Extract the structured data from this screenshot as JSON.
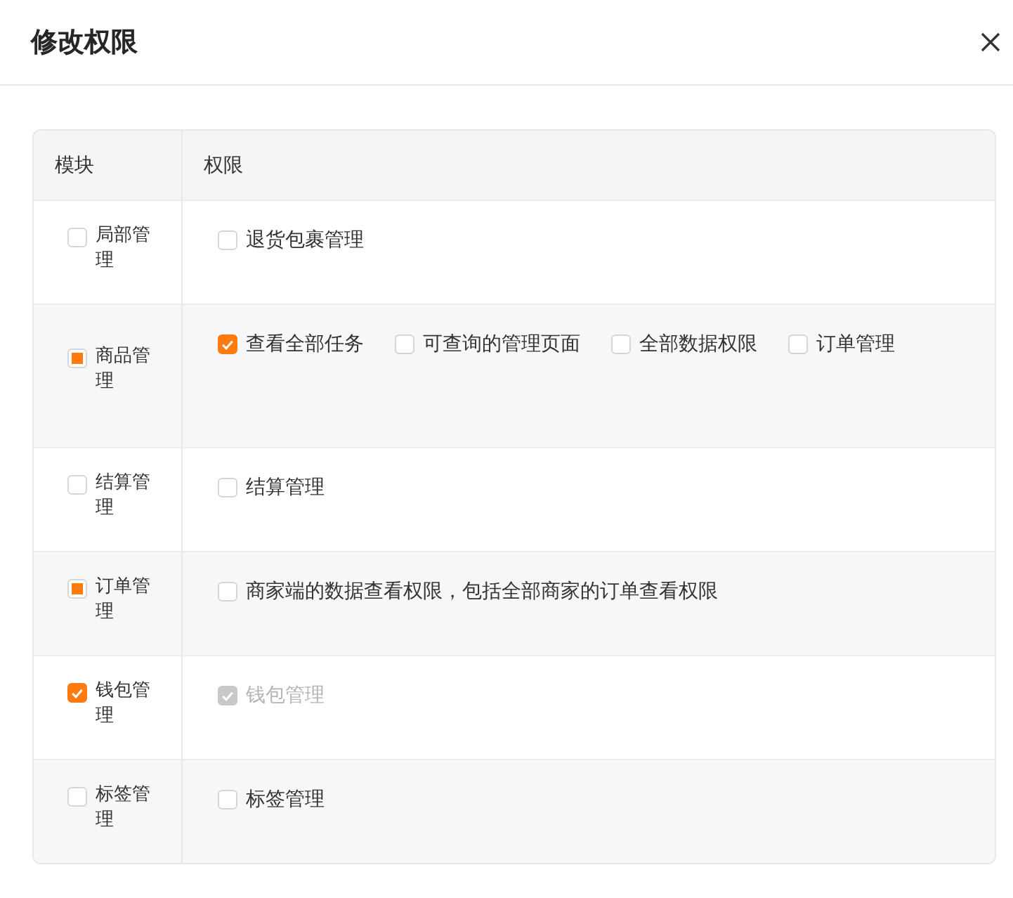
{
  "dialog": {
    "title": "修改权限"
  },
  "table": {
    "columns": [
      "模块",
      "权限"
    ],
    "rows": [
      {
        "module": {
          "label": "局部管理",
          "checked": false,
          "indeterminate": false
        },
        "permissions": [
          {
            "label": "退货包裹管理",
            "checked": false,
            "disabled": false
          }
        ]
      },
      {
        "module": {
          "label": "商品管理",
          "checked": false,
          "indeterminate": true
        },
        "permissions": [
          {
            "label": "查看全部任务",
            "checked": true,
            "disabled": false
          },
          {
            "label": "可查询的管理页面",
            "checked": false,
            "disabled": false
          },
          {
            "label": "全部数据权限",
            "checked": false,
            "disabled": false
          },
          {
            "label": "订单管理",
            "checked": false,
            "disabled": false
          }
        ]
      },
      {
        "module": {
          "label": "结算管理",
          "checked": false,
          "indeterminate": false
        },
        "permissions": [
          {
            "label": "结算管理",
            "checked": false,
            "disabled": false
          }
        ]
      },
      {
        "module": {
          "label": "订单管理",
          "checked": false,
          "indeterminate": true
        },
        "permissions": [
          {
            "label": "商家端的数据查看权限，包括全部商家的订单查看权限",
            "checked": false,
            "disabled": false
          }
        ]
      },
      {
        "module": {
          "label": "钱包管理",
          "checked": true,
          "indeterminate": false
        },
        "permissions": [
          {
            "label": "钱包管理",
            "checked": true,
            "disabled": true
          }
        ]
      },
      {
        "module": {
          "label": "标签管理",
          "checked": false,
          "indeterminate": false
        },
        "permissions": [
          {
            "label": "标签管理",
            "checked": false,
            "disabled": false
          }
        ]
      }
    ]
  }
}
